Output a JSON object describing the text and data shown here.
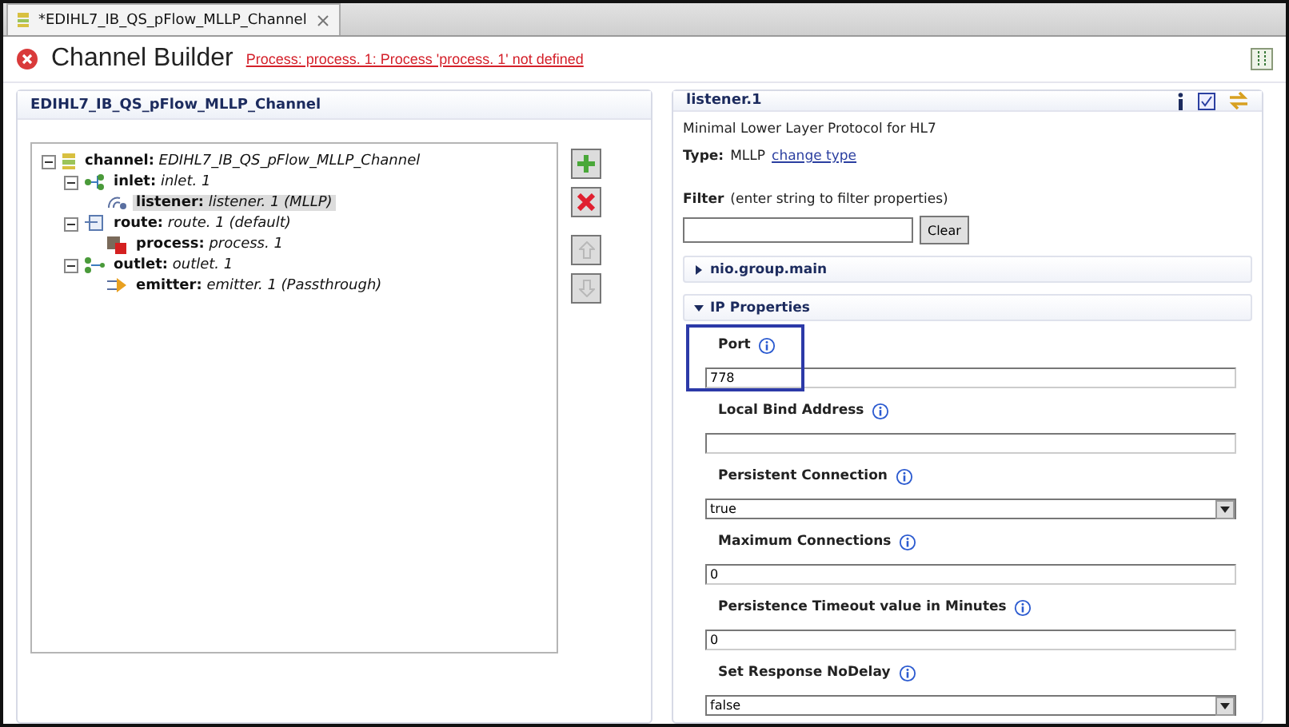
{
  "tab": {
    "title": "*EDIHL7_IB_QS_pFlow_MLLP_Channel"
  },
  "header": {
    "title": "Channel Builder",
    "error": "Process: process. 1: Process 'process. 1' not defined"
  },
  "left_panel": {
    "title": "EDIHL7_IB_QS_pFlow_MLLP_Channel",
    "tree": [
      {
        "kind": "channel",
        "key": "channel:",
        "value": "EDIHL7_IB_QS_pFlow_MLLP_Channel",
        "selected": false,
        "expanded": true,
        "children": [
          {
            "kind": "inlet",
            "key": "inlet:",
            "value": "inlet. 1",
            "selected": false,
            "expanded": true,
            "children": [
              {
                "kind": "listener",
                "key": "listener:",
                "value": "listener. 1 (MLLP)",
                "selected": true
              }
            ]
          },
          {
            "kind": "route",
            "key": "route:",
            "value": "route. 1 (default)",
            "selected": false,
            "expanded": true,
            "children": [
              {
                "kind": "process",
                "key": "process:",
                "value": "process. 1",
                "selected": false
              }
            ]
          },
          {
            "kind": "outlet",
            "key": "outlet:",
            "value": "outlet. 1",
            "selected": false,
            "expanded": true,
            "children": [
              {
                "kind": "emitter",
                "key": "emitter:",
                "value": "emitter. 1 (Passthrough)",
                "selected": false
              }
            ]
          }
        ]
      }
    ],
    "buttons": [
      {
        "kind": "add",
        "disabled": false
      },
      {
        "kind": "delete",
        "disabled": false
      },
      {
        "kind": "up",
        "disabled": true
      },
      {
        "kind": "down",
        "disabled": true
      }
    ]
  },
  "right_panel": {
    "title": "listener.1",
    "description": "Minimal Lower Layer Protocol for HL7",
    "type_label": "Type:",
    "type_value": "MLLP",
    "change_link": "change type",
    "filter_label": "Filter",
    "filter_hint": "(enter string to filter properties)",
    "clear_button": "Clear",
    "sections": [
      {
        "title": "nio.group.main",
        "expanded": false
      },
      {
        "title": "IP Properties",
        "expanded": true
      }
    ],
    "fields": [
      {
        "kind": "text",
        "label": "Port",
        "value": "778",
        "highlighted": true
      },
      {
        "kind": "text",
        "label": "Local Bind Address",
        "highlighted": false
      },
      {
        "kind": "select",
        "label": "Persistent Connection",
        "value": "true",
        "highlighted": false
      },
      {
        "kind": "text",
        "label": "Maximum Connections",
        "value": "0",
        "highlighted": false
      },
      {
        "kind": "text",
        "label": "Persistence Timeout value in Minutes",
        "value": "0",
        "highlighted": false
      },
      {
        "kind": "select",
        "label": "Set Response NoDelay",
        "value": "false",
        "highlighted": false
      }
    ]
  }
}
